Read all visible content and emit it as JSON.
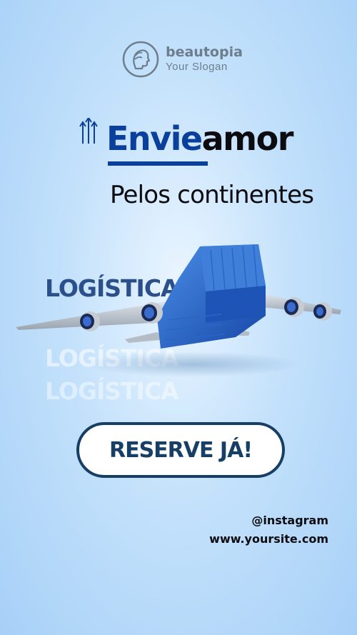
{
  "brand": {
    "name": "beautopia",
    "slogan": "Your Slogan",
    "icon": "head-profile-icon"
  },
  "headline": {
    "part1": "Envie",
    "part2": "amor",
    "subtitle": "Pelos continentes"
  },
  "watermark": {
    "text": "LOGÍSTICA"
  },
  "hero": {
    "icon": "cargo-plane-icon"
  },
  "cta": {
    "label": "RESERVE JÁ!"
  },
  "contact": {
    "instagram": "@instagram",
    "website": "www.yoursite.com"
  },
  "colors": {
    "primary_blue": "#0a3f9b",
    "dark_navy": "#173f66",
    "text_dark": "#0c0c10",
    "background_light": "#c3e1fb"
  }
}
